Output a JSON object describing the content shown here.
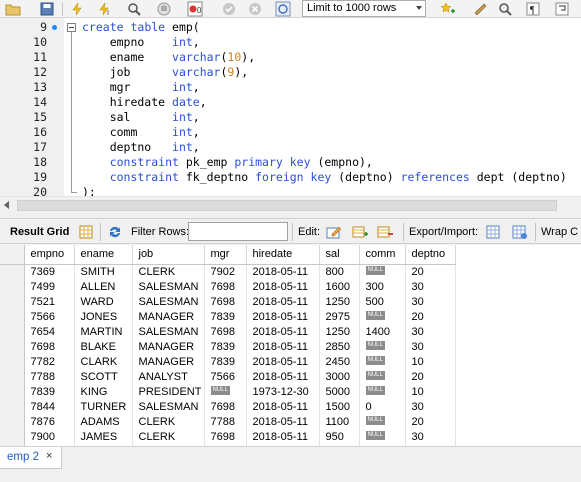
{
  "toolbar": {
    "limit_value": "Limit to 1000 rows",
    "icons": [
      "folder-icon",
      "save-icon",
      "execute-icon",
      "execute-current-icon",
      "explain-icon",
      "stop-icon",
      "toggle-error-icon",
      "commit-icon",
      "rollback-icon",
      "autocommit-icon",
      "beautify-icon",
      "find-icon",
      "invisible-chars-icon",
      "wrap-icon"
    ]
  },
  "editor": {
    "lines": [
      {
        "n": "9",
        "code": [
          "create table emp("
        ]
      },
      {
        "n": "10",
        "code": [
          "    empno    int,"
        ]
      },
      {
        "n": "11",
        "code": [
          "    ename    varchar(10),"
        ]
      },
      {
        "n": "12",
        "code": [
          "    job      varchar(9),"
        ]
      },
      {
        "n": "13",
        "code": [
          "    mgr      int,"
        ]
      },
      {
        "n": "14",
        "code": [
          "    hiredate date,"
        ]
      },
      {
        "n": "15",
        "code": [
          "    sal      int,"
        ]
      },
      {
        "n": "16",
        "code": [
          "    comm     int,"
        ]
      },
      {
        "n": "17",
        "code": [
          "    deptno   int,"
        ]
      },
      {
        "n": "18",
        "code": [
          "    constraint pk_emp primary key (empno),"
        ]
      },
      {
        "n": "19",
        "code": [
          "    constraint fk_deptno foreign key (deptno) references dept (deptno)"
        ]
      },
      {
        "n": "20",
        "code": [
          ");"
        ]
      }
    ]
  },
  "result_toolbar": {
    "result_grid": "Result Grid",
    "filter_rows": "Filter Rows:",
    "filter_value": "",
    "edit": "Edit:",
    "export_import": "Export/Import:",
    "wrap": "Wrap C"
  },
  "grid": {
    "columns": [
      "empno",
      "ename",
      "job",
      "mgr",
      "hiredate",
      "sal",
      "comm",
      "deptno"
    ],
    "null_label": "NULL",
    "rows": [
      [
        "7369",
        "SMITH",
        "CLERK",
        "7902",
        "2018-05-11",
        "800",
        null,
        "20"
      ],
      [
        "7499",
        "ALLEN",
        "SALESMAN",
        "7698",
        "2018-05-11",
        "1600",
        "300",
        "30"
      ],
      [
        "7521",
        "WARD",
        "SALESMAN",
        "7698",
        "2018-05-11",
        "1250",
        "500",
        "30"
      ],
      [
        "7566",
        "JONES",
        "MANAGER",
        "7839",
        "2018-05-11",
        "2975",
        null,
        "20"
      ],
      [
        "7654",
        "MARTIN",
        "SALESMAN",
        "7698",
        "2018-05-11",
        "1250",
        "1400",
        "30"
      ],
      [
        "7698",
        "BLAKE",
        "MANAGER",
        "7839",
        "2018-05-11",
        "2850",
        null,
        "30"
      ],
      [
        "7782",
        "CLARK",
        "MANAGER",
        "7839",
        "2018-05-11",
        "2450",
        null,
        "10"
      ],
      [
        "7788",
        "SCOTT",
        "ANALYST",
        "7566",
        "2018-05-11",
        "3000",
        null,
        "20"
      ],
      [
        "7839",
        "KING",
        "PRESIDENT",
        null,
        "1973-12-30",
        "5000",
        null,
        "10"
      ],
      [
        "7844",
        "TURNER",
        "SALESMAN",
        "7698",
        "2018-05-11",
        "1500",
        "0",
        "30"
      ],
      [
        "7876",
        "ADAMS",
        "CLERK",
        "7788",
        "2018-05-11",
        "1100",
        null,
        "20"
      ],
      [
        "7900",
        "JAMES",
        "CLERK",
        "7698",
        "2018-05-11",
        "950",
        null,
        "30"
      ],
      [
        "",
        "",
        "",
        "",
        "",
        "",
        "",
        ""
      ]
    ]
  },
  "tab": {
    "label": "emp 2",
    "close": "×"
  }
}
